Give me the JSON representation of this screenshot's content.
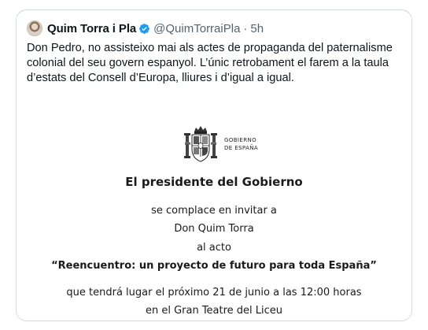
{
  "tweet": {
    "display_name": "Quim Torra i Pla",
    "verified_icon": "verified-badge-icon",
    "handle": "@QuimTorraiPla",
    "separator": "·",
    "time": "5h",
    "text": "Don Pedro, no assisteixo mai als actes de propaganda del paternalisme colonial del seu govern espanyol. L’únic retrobament el farem a la taula d’estats del Consell d’Europa, lliures i d’igual a igual."
  },
  "invitation": {
    "crest_icon": "spanish-coat-of-arms-icon",
    "gov_line1": "GOBIERNO",
    "gov_line2": "DE ESPAÑA",
    "title": "El presidente del Gobierno",
    "line1": "se complace en invitar a",
    "line2": "Don Quim Torra",
    "line3": "al acto",
    "event": "“Reencuentro: un proyecto de futuro para toda España”",
    "line5": "que tendrá lugar el próximo 21 de junio a las 12:00 horas",
    "line6": "en el Gran Teatre del Liceu"
  },
  "colors": {
    "verified_blue": "#1d9bf0",
    "secondary_text": "#536471",
    "primary_text": "#0f1419",
    "border": "#cfd9de"
  }
}
